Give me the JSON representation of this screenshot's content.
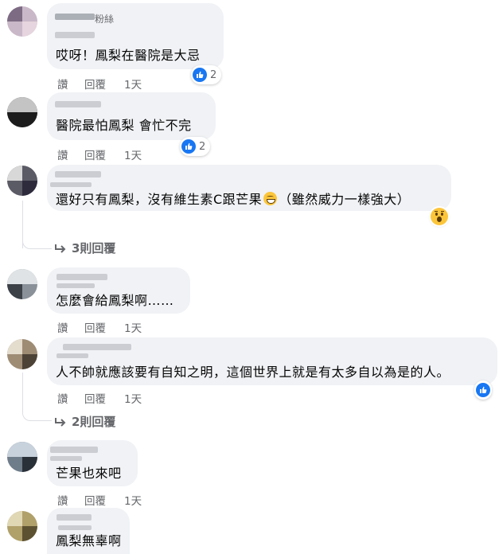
{
  "comments": [
    {
      "name_suffix": "粉絲",
      "text": "哎呀！鳳梨在醫院是大忌",
      "reply": "讚",
      "reply2": "回覆",
      "time": "1天",
      "likes": "2"
    },
    {
      "text": "醫院最怕鳳梨 會忙不完",
      "reply": "讚",
      "reply2": "回覆",
      "time": "1天",
      "likes": "2"
    },
    {
      "text_a": "還好只有鳳梨，沒有維生素C跟芒果",
      "text_b": "（雖然威力一樣強大）",
      "replies": "3則回覆"
    },
    {
      "text": "怎麼會給鳳梨啊……",
      "reply": "讚",
      "reply2": "回覆",
      "time": "1天"
    },
    {
      "text": "人不帥就應該要有自知之明，這個世界上就是有太多自以為是的人。",
      "reply": "讚",
      "reply2": "回覆",
      "time": "1天",
      "replies": "2則回覆"
    },
    {
      "text": "芒果也來吧",
      "reply": "讚",
      "reply2": "回覆",
      "time": "1天"
    },
    {
      "text": "鳳梨無辜啊"
    }
  ],
  "colors": {
    "like_blue": "#1877f2",
    "bubble": "#f0f2f5",
    "meta": "#65676b"
  },
  "icons": {
    "like": "thumbs-up-icon",
    "wow": "wow-emoji-icon",
    "grin": "grinning-emoji-icon",
    "reply_arrow": "reply-arrow-icon"
  }
}
